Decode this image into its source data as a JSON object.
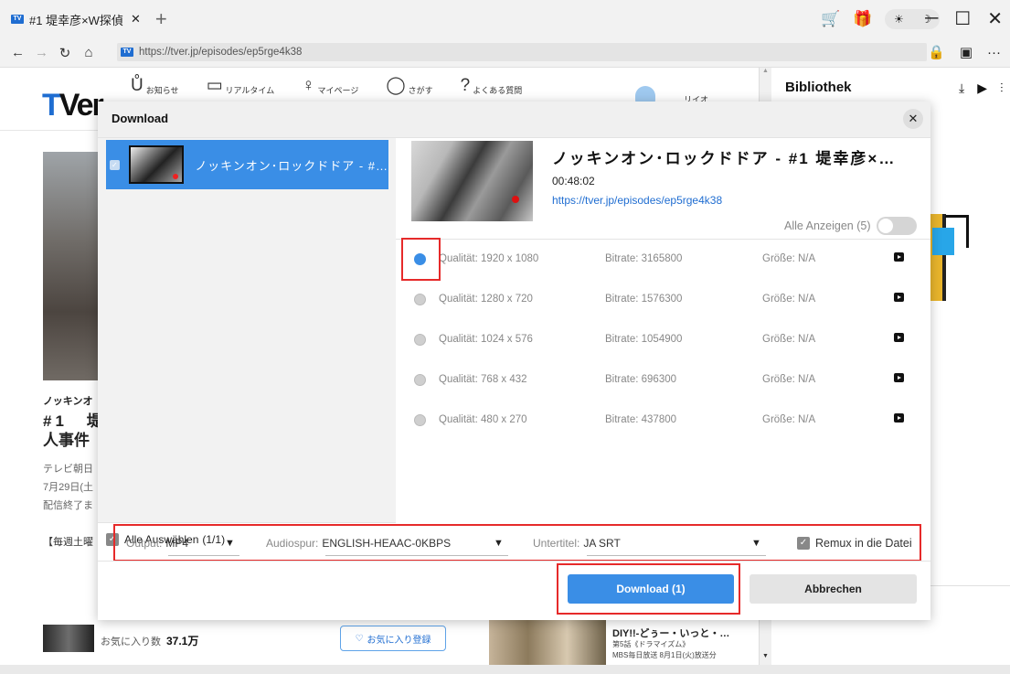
{
  "browser": {
    "tab_favicon": "TV",
    "tab_title": "#1  堤幸彦×W探偵",
    "tab_close": "✕",
    "new_tab": "+",
    "url_favicon": "TV",
    "url": "https://tver.jp/episodes/ep5rge4k38",
    "theme_sun": "☀",
    "theme_moon": "☽",
    "win_min": "─",
    "win_max": "☐",
    "win_close": "✕",
    "more": "···"
  },
  "page": {
    "logo_t": "T",
    "logo_ver": "Ver",
    "nav": [
      {
        "icon": "bell-icon",
        "glyph": "Ů",
        "label": "お知らせ"
      },
      {
        "icon": "tv-icon",
        "glyph": "▭",
        "label": "リアルタイム"
      },
      {
        "icon": "user-icon",
        "glyph": "♀",
        "label": "マイページ"
      },
      {
        "icon": "search-icon",
        "glyph": "◯",
        "label": "さがす"
      },
      {
        "icon": "help-icon",
        "glyph": "?",
        "label": "よくある質問"
      }
    ],
    "login_label": "リイオ",
    "hero_title1": "ノッキンオ",
    "hero_title2": "#1　堤",
    "hero_title3": "人事件",
    "hero_meta1": "テレビ朝日",
    "hero_meta2": "7月29日(土",
    "hero_meta3": "配信終了ま",
    "hero_tag": "【毎週土曜",
    "fav_label": "お気に入り数",
    "fav_count": "37.1万",
    "fav_button": "お気に入り登録",
    "promo_title": "DIY!!-どぅー・いっと・…",
    "promo_sub1": "第5話《ドラマイズム》",
    "promo_sub2": "MBS毎日放送 8月1日(火)放送分"
  },
  "library": {
    "title": "Bibliothek"
  },
  "modal": {
    "title": "Download",
    "close": "✕",
    "list": [
      {
        "title": "ノッキンオン･ロックドドア - #…",
        "checked": true
      }
    ],
    "select_all_label": "Alle Auswählen",
    "select_all_count": "(1/1)",
    "detail": {
      "title": "ノッキンオン･ロックドドア - #1 堤幸彦×…",
      "duration": "00:48:02",
      "url": "https://tver.jp/episodes/ep5rge4k38",
      "show_all_label": "Alle Anzeigen (5)",
      "show_all_on": false
    },
    "qualities": [
      {
        "quality": "Qualität: 1920 x 1080",
        "bitrate": "Bitrate: 3165800",
        "size": "Größe: N/A",
        "selected": true
      },
      {
        "quality": "Qualität: 1280 x 720",
        "bitrate": "Bitrate: 1576300",
        "size": "Größe: N/A",
        "selected": false
      },
      {
        "quality": "Qualität: 1024 x 576",
        "bitrate": "Bitrate: 1054900",
        "size": "Größe: N/A",
        "selected": false
      },
      {
        "quality": "Qualität: 768 x 432",
        "bitrate": "Bitrate: 696300",
        "size": "Größe: N/A",
        "selected": false
      },
      {
        "quality": "Qualität: 480 x 270",
        "bitrate": "Bitrate: 437800",
        "size": "Größe: N/A",
        "selected": false
      }
    ],
    "options": {
      "output_label": "Output:",
      "output_value": "MP4",
      "audio_label": "Audiospur:",
      "audio_value": "ENGLISH-HEAAC-0KBPS",
      "subtitle_label": "Untertitel:",
      "subtitle_value": "JA SRT",
      "remux_label": "Remux in die Datei",
      "remux_checked": true
    },
    "download_button": "Download (1)",
    "cancel_button": "Abbrechen"
  },
  "colors": {
    "accent": "#3a8ee6",
    "highlight": "#e62a2a"
  }
}
